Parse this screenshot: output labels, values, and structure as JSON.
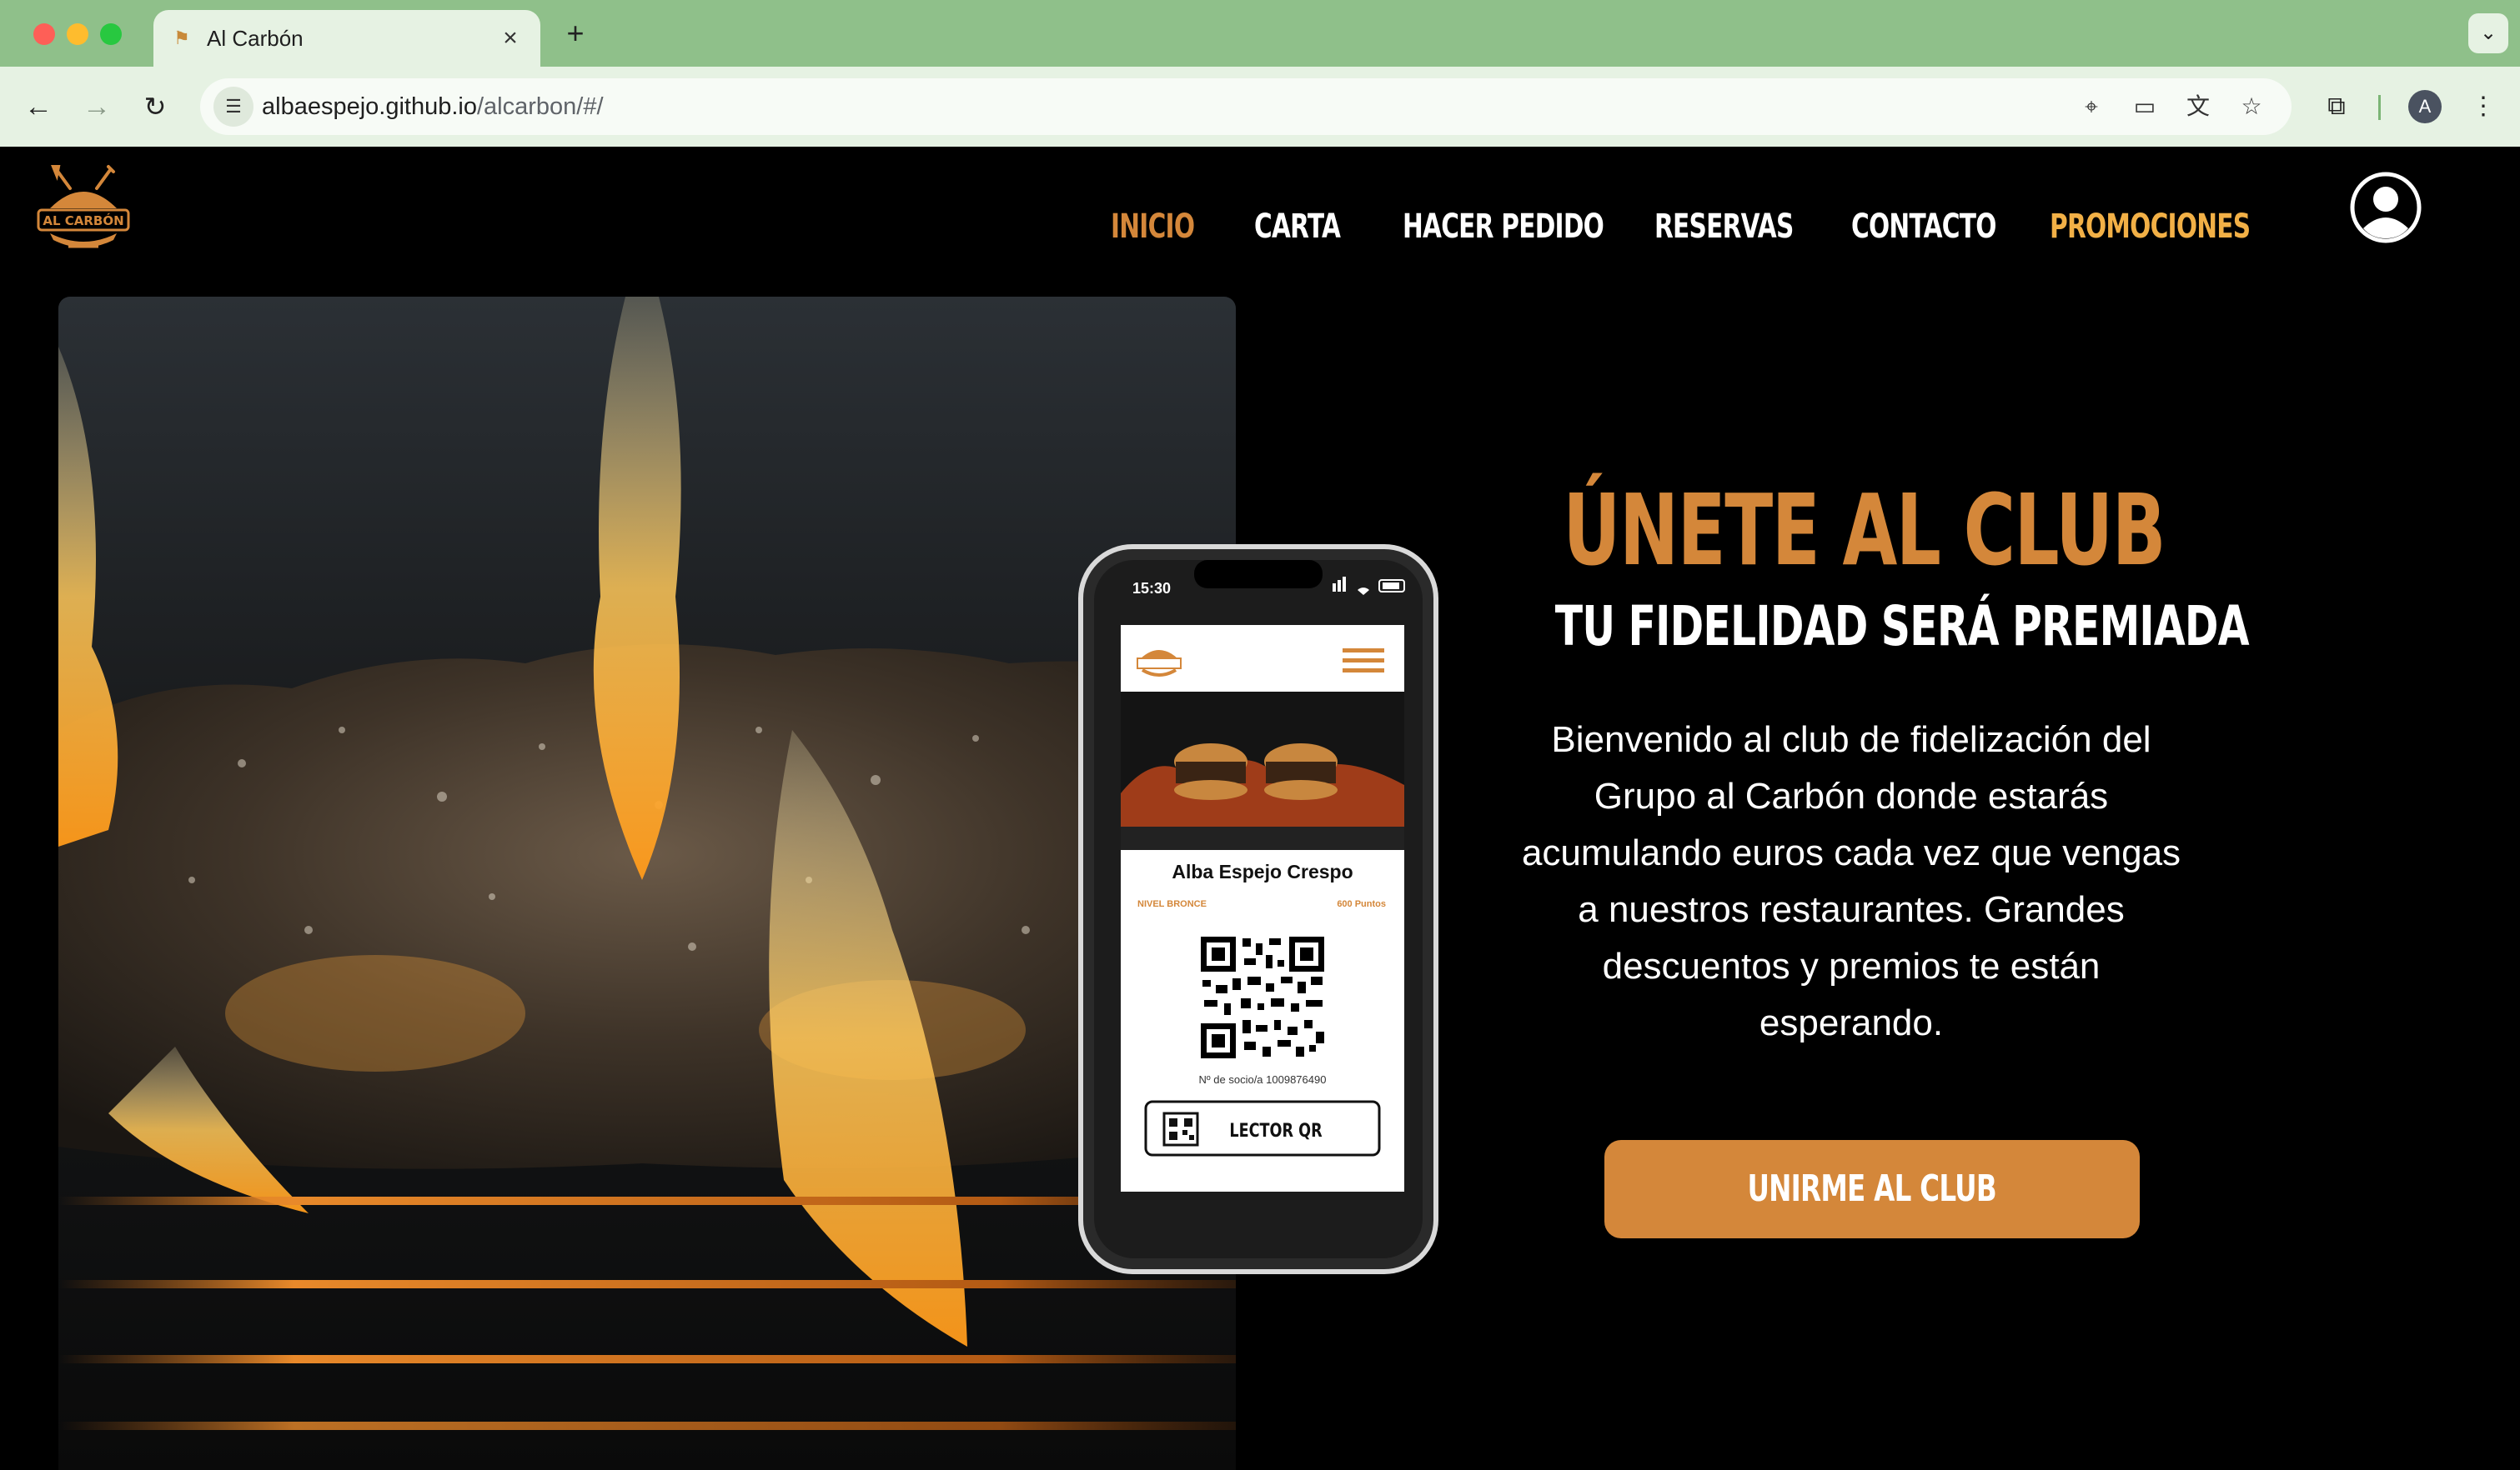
{
  "browser": {
    "tab_title": "Al Carbón",
    "tab_close": "×",
    "new_tab": "+",
    "tab_menu": "⌄",
    "url_host": "albaespejo.github.io",
    "url_path": "/alcarbon/#/",
    "profile_initial": "A"
  },
  "nav": {
    "items": [
      {
        "label": "INICIO",
        "state": "active"
      },
      {
        "label": "CARTA"
      },
      {
        "label": "HACER PEDIDO"
      },
      {
        "label": "RESERVAS"
      },
      {
        "label": "CONTACTO"
      },
      {
        "label": "PROMOCIONES",
        "state": "highlight"
      }
    ]
  },
  "logo": {
    "text": "AL CARBÓN"
  },
  "phone": {
    "time": "15:30",
    "member_name": "Alba Espejo Crespo",
    "level": "NIVEL BRONCE",
    "points": "600 Puntos",
    "member_number": "Nº de socio/a 1009876490",
    "qr_button": "LECTOR QR"
  },
  "club": {
    "title": "ÚNETE AL CLUB",
    "subtitle": "TU FIDELIDAD SERÁ PREMIADA",
    "text": "Bienvenido al club de fidelización del Grupo al Carbón donde estarás acumulando euros cada vez que vengas a nuestros restaurantes. Grandes descuentos y premios te están esperando.",
    "button": "UNIRME AL CLUB"
  },
  "colors": {
    "accent": "#d4873a",
    "promo": "#f2b046",
    "chrome": "#8fc08a",
    "background": "#000000"
  }
}
